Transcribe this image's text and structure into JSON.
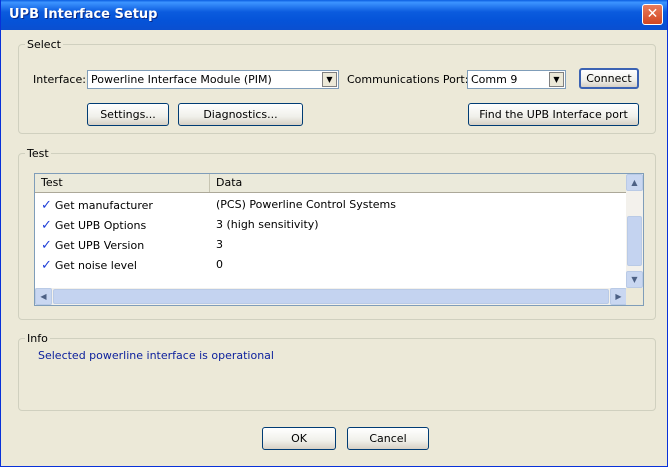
{
  "window": {
    "title": "UPB Interface Setup",
    "close_glyph": "✕"
  },
  "select_group": {
    "legend": "Select",
    "interface_label": "Interface:",
    "interface_value": "Powerline Interface Module (PIM)",
    "port_label": "Communications Port:",
    "port_value": "Comm 9",
    "connect_button": "Connect",
    "settings_button": "Settings...",
    "diagnostics_button": "Diagnostics...",
    "find_button": "Find the UPB Interface port"
  },
  "test_group": {
    "legend": "Test",
    "columns": [
      "Test",
      "Data"
    ],
    "rows": [
      {
        "test": "Get manufacturer",
        "data": "(PCS) Powerline Control Systems",
        "icon": "checkmark-icon"
      },
      {
        "test": "Get UPB Options",
        "data": "3 (high sensitivity)",
        "icon": "checkmark-icon"
      },
      {
        "test": "Get UPB Version",
        "data": "3",
        "icon": "checkmark-icon"
      },
      {
        "test": "Get noise level",
        "data": "0",
        "icon": "checkmark-icon"
      }
    ],
    "check_glyph": "✓"
  },
  "info_group": {
    "legend": "Info",
    "message": "Selected powerline interface is operational"
  },
  "buttons": {
    "ok": "OK",
    "cancel": "Cancel"
  },
  "colors": {
    "title_bar": "#0553d8",
    "info_text": "#0a1e9c",
    "check": "#1f3fd8"
  }
}
